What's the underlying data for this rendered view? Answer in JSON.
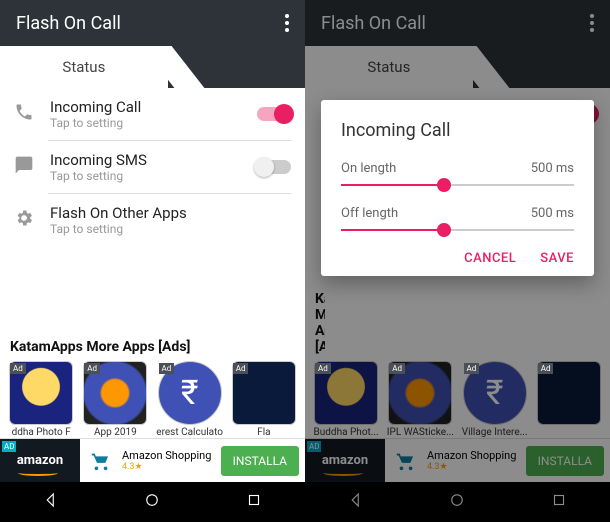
{
  "app_title": "Flash On Call",
  "tab_label": "Status",
  "rows": [
    {
      "title": "Incoming Call",
      "sub": "Tap to setting",
      "toggle": "on"
    },
    {
      "title": "Incoming SMS",
      "sub": "Tap to setting",
      "toggle": "off"
    },
    {
      "title": "Flash On Other Apps",
      "sub": "Tap to setting",
      "toggle": null
    }
  ],
  "ads_header": "KatamApps More Apps [Ads]",
  "ad_badge": "Ad",
  "ads_left": [
    {
      "cap": "ddha Photo F"
    },
    {
      "cap": "App 2019"
    },
    {
      "cap": "erest Calculato"
    },
    {
      "cap": "Fla"
    }
  ],
  "ads_right": [
    {
      "cap": "Buddha Phot..."
    },
    {
      "cap": "IPL WASticke..."
    },
    {
      "cap": "Village Intere..."
    },
    {
      "cap": ""
    }
  ],
  "banner": {
    "brand": "amazon",
    "title": "Amazon Shopping",
    "rating": "4.3★",
    "cta": "INSTALLA",
    "ad_badge": "AD"
  },
  "dialog": {
    "title": "Incoming Call",
    "on_label": "On length",
    "off_label": "Off length",
    "on_value": "500 ms",
    "off_value": "500 ms",
    "on_pct": 44,
    "off_pct": 44,
    "cancel": "CANCEL",
    "save": "SAVE"
  }
}
